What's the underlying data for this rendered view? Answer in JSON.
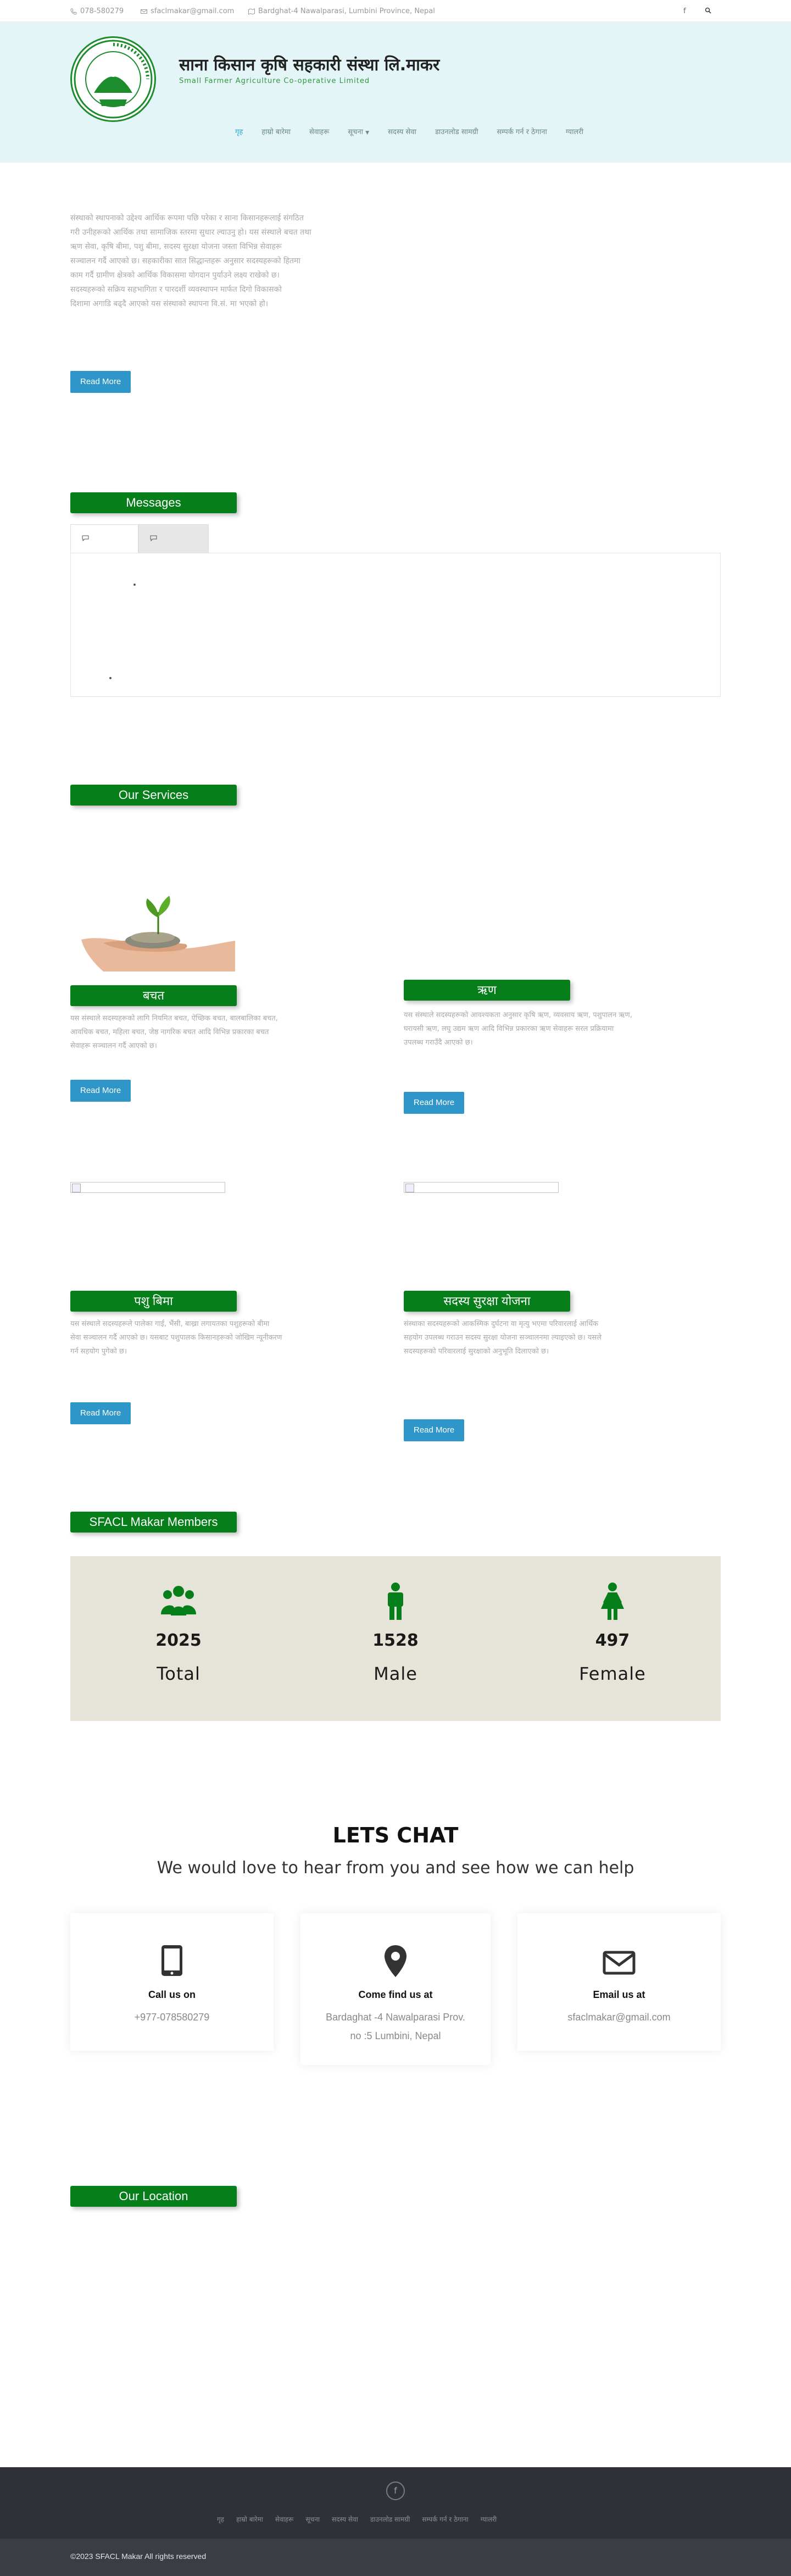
{
  "topbar": {
    "phone": "078-580279",
    "email": "sfaclmakar@gmail.com",
    "address": "Bardghat-4 Nawalparasi, Lumbini Province, Nepal"
  },
  "header": {
    "title": "साना किसान कृषि सहकारी संस्था लि.माकर",
    "tagline": "Small Farmer Agriculture Co-operative Limited",
    "logo_text": "साना किसान कृषि सहकारी संस्था लि."
  },
  "nav": {
    "items": [
      "गृह",
      "हाम्रो बारेमा",
      "सेवाहरू",
      "सूचना",
      "सदस्य सेवा",
      "डाउनलोड सामग्री",
      "सम्पर्क गर्न र ठेगाना",
      "ग्यालरी"
    ]
  },
  "intro": {
    "lines": [
      "संस्थाको स्थापनाको उद्देश्य आर्थिक रूपमा पछि परेका र साना किसानहरूलाई संगठित",
      "गरी उनीहरूको आर्थिक तथा सामाजिक स्तरमा सुधार ल्याउनु हो। यस संस्थाले बचत तथा",
      "ऋण सेवा, कृषि बीमा, पशु बीमा, सदस्य सुरक्षा योजना जस्ता विभिन्न सेवाहरू",
      "सञ्चालन गर्दै आएको छ। सहकारीका सात सिद्धान्तहरू अनुसार सदस्यहरूको हितमा",
      "काम गर्दै ग्रामीण क्षेत्रको आर्थिक विकासमा योगदान पुर्याउने लक्ष्य राखेको छ।",
      "सदस्यहरूको सक्रिय सहभागिता र पारदर्शी व्यवस्थापन मार्फत दिगो विकासको",
      "दिशामा अगाडि बढ्दै आएको यस संस्थाको स्थापना वि.सं. मा भएको हो।"
    ],
    "read_more": "Read More"
  },
  "messages": {
    "heading": "Messages",
    "tab1": "",
    "tab2": ""
  },
  "services": {
    "heading": "Our Services",
    "items": [
      {
        "title": "बचत",
        "lines": [
          "यस संस्थाले सदस्यहरूको लागि नियमित बचत, ऐच्छिक बचत, बालबालिका बचत,",
          "आवधिक बचत, महिला बचत, जेष्ठ नागरिक बचत आदि विभिन्न प्रकारका बचत",
          "सेवाहरू सञ्चालन गर्दै आएको छ।"
        ],
        "read_more": "Read More"
      },
      {
        "title": "ऋण",
        "lines": [
          "यस संस्थाले सदस्यहरूको आवश्यकता अनुसार कृषि ऋण, व्यवसाय ऋण, पशुपालन ऋण,",
          "घरायसी ऋण, लघु उद्यम ऋण आदि विभिन्न प्रकारका ऋण सेवाहरू सरल प्रक्रियामा",
          "उपलब्ध गराउँदै आएको छ।"
        ],
        "read_more": "Read More"
      },
      {
        "title": "पशु बिमा",
        "lines": [
          "यस संस्थाले सदस्यहरूले पालेका गाई, भैंसी, बाख्रा लगायतका पशुहरूको बीमा",
          "सेवा सञ्चालन गर्दै आएको छ। यसबाट पशुपालक किसानहरूको जोखिम न्यूनीकरण",
          "गर्न सहयोग पुगेको छ।"
        ],
        "read_more": "Read More"
      },
      {
        "title": "सदस्य सुरक्षा योजना",
        "lines": [
          "संस्थाका सदस्यहरूको आकस्मिक दुर्घटना वा मृत्यु भएमा परिवारलाई आर्थिक",
          "सहयोग उपलब्ध गराउन सदस्य सुरक्षा योजना सञ्चालनमा ल्याइएको छ। यसले",
          "सदस्यहरूको परिवारलाई सुरक्षाको अनुभूति दिलाएको छ।"
        ],
        "read_more": "Read More"
      }
    ]
  },
  "members": {
    "heading": "SFACL Makar Members",
    "stats": [
      {
        "value": "2025",
        "label": "Total",
        "icon": "group-icon"
      },
      {
        "value": "1528",
        "label": "Male",
        "icon": "male-icon"
      },
      {
        "value": "497",
        "label": "Female",
        "icon": "female-icon"
      }
    ],
    "icon_color": "#067f1a"
  },
  "chat": {
    "title": "LETS CHAT",
    "subtitle": "We would love to hear from you and see how we can help",
    "cards": [
      {
        "heading": "Call us on",
        "text1": "+977-078580279",
        "text2": ""
      },
      {
        "heading": "Come find us at",
        "text1": "Bardaghat -4 Nawalparasi Prov.",
        "text2": "no :5 Lumbini, Nepal"
      },
      {
        "heading": "Email us at",
        "text1": "sfaclmakar@gmail.com",
        "text2": ""
      }
    ]
  },
  "location": {
    "heading": "Our Location"
  },
  "footer": {
    "facebook_label": "f",
    "nav": [
      "गृह",
      "हाम्रो बारेमा",
      "सेवाहरू",
      "सूचना",
      "सदस्य सेवा",
      "डाउनलोड सामग्री",
      "सम्पर्क गर्न र ठेगाना",
      "ग्यालरी"
    ],
    "copyright": "©2023 SFACL Makar All rights reserved"
  },
  "colors": {
    "brand_green": "#067f1a",
    "button_blue": "#2e96c9",
    "header_bg": "#e3f5f7",
    "footer_bg": "#2f3138"
  }
}
